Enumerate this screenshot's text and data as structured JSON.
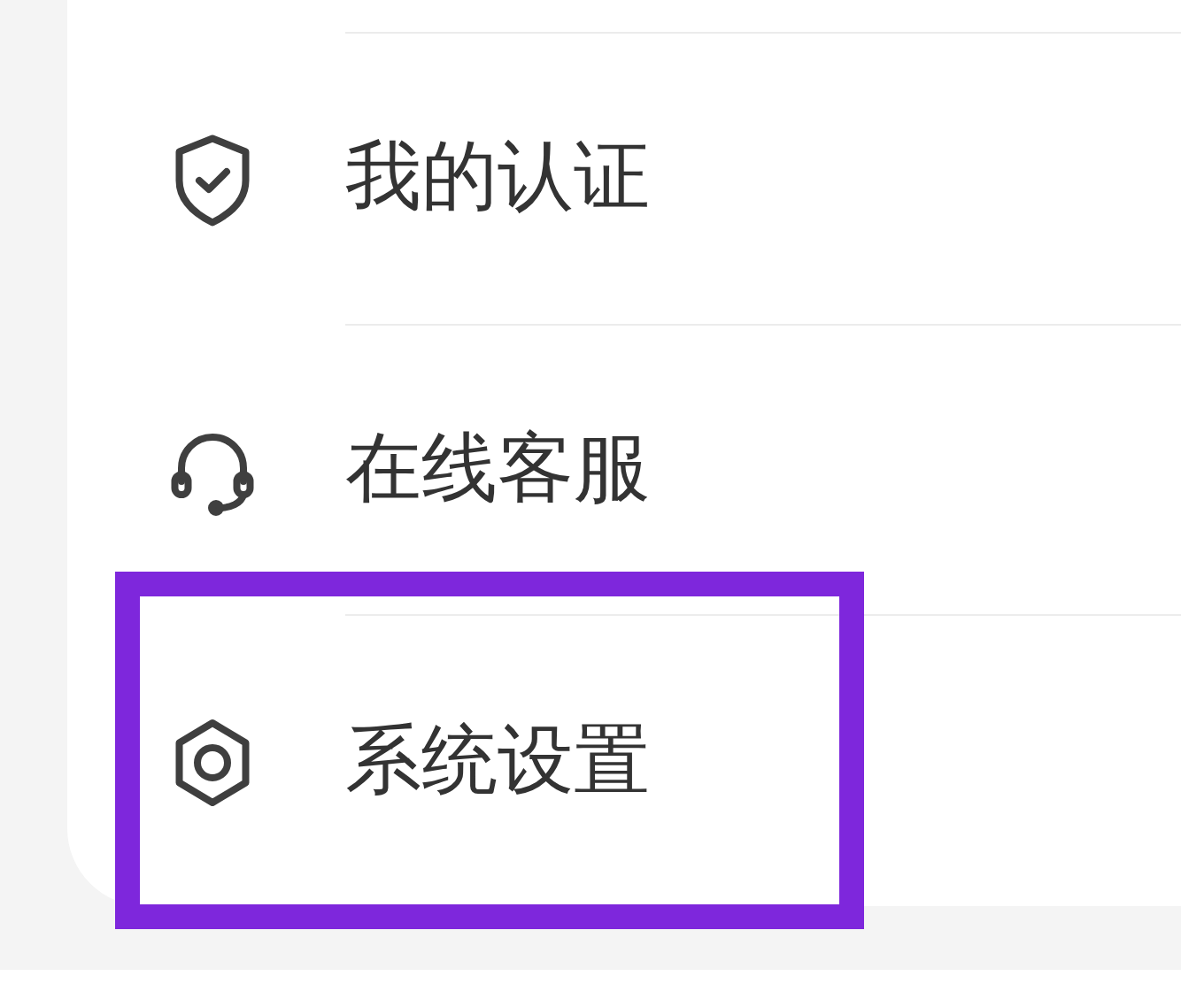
{
  "menu": [
    {
      "kind": "shield",
      "label": "我的认证",
      "highlighted": false
    },
    {
      "kind": "headset",
      "label": "在线客服",
      "highlighted": false
    },
    {
      "kind": "settings",
      "label": "系统设置",
      "highlighted": true
    }
  ]
}
